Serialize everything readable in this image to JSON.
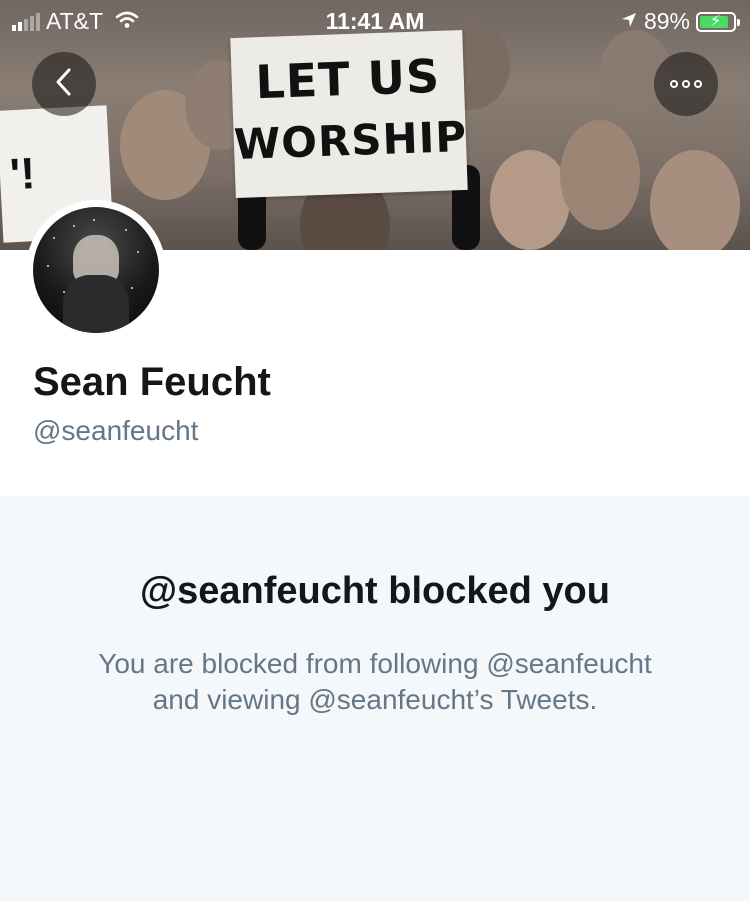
{
  "status_bar": {
    "carrier": "AT&T",
    "time": "11:41 AM",
    "battery_percent": "89%",
    "battery_level": 0.89,
    "signal_bars": 2
  },
  "header": {
    "banner_sign_text": [
      "LET US",
      "WORSHIP"
    ],
    "back_icon": "chevron-left-icon",
    "more_icon": "ellipsis-icon"
  },
  "profile": {
    "display_name": "Sean Feucht",
    "handle": "@seanfeucht"
  },
  "blocked": {
    "title": "@seanfeucht blocked you",
    "body_line_1": "You are blocked from following @seanfeucht",
    "body_line_2": "and viewing @seanfeucht’s Tweets."
  },
  "colors": {
    "primary_text": "#14171a",
    "secondary_text": "#657786",
    "panel_background": "#f5f8fa",
    "battery_green": "#4cd964"
  }
}
